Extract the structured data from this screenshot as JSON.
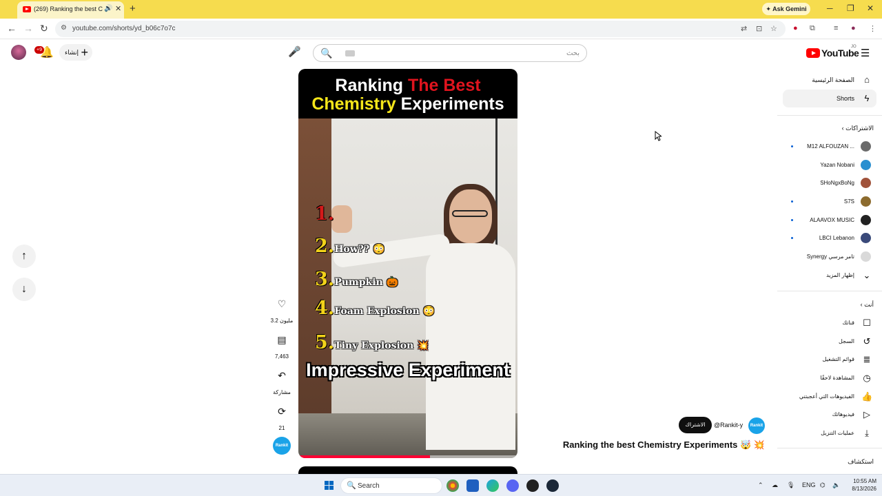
{
  "browser": {
    "tab_title": "(269) Ranking the best Che",
    "tab_audio_icon": "speaker-icon",
    "ask_gemini": "Ask Gemini",
    "url": "youtube.com/shorts/yd_b06c7o7c"
  },
  "header": {
    "notification_count": "+9",
    "create_label": "إنشاء",
    "search_placeholder": "بحث",
    "logo_text": "YouTube",
    "logo_country": "JO"
  },
  "short": {
    "title_line1_white": "Ranking ",
    "title_line1_red": "The Best",
    "title_line2_yellow": "Chemistry",
    "title_line2_white": " Experiments",
    "ranks": [
      {
        "num": "1.",
        "text": ""
      },
      {
        "num": "2.",
        "text": "How?? 😳"
      },
      {
        "num": "3.",
        "text": "Pumpkin 🎃"
      },
      {
        "num": "4.",
        "text": "Foam Explosion 😳"
      },
      {
        "num": "5.",
        "text": "Tiny Explosion 💥"
      }
    ],
    "caption": "Impressive Experiment",
    "progress": 0.6
  },
  "actions": {
    "likes": "3.2 مليون",
    "comments": "7,463",
    "share": "مشاركة",
    "remix": "21",
    "channel_avatar_text": "Rankit"
  },
  "video_info": {
    "subscribe": "الاشتراك",
    "handle": "@Rankit-y",
    "title": "Ranking the best Chemistry Experiments 🤯 💥"
  },
  "sidebar": {
    "home": "الصفحة الرئيسية",
    "shorts": "Shorts",
    "subscriptions_header": "الاشتراكات",
    "subscriptions": [
      {
        "name": "M12 ALFOUZAN ...",
        "color": "#6b6b6b",
        "dot": true
      },
      {
        "name": "Yazan Nobani",
        "color": "#2a8fd0",
        "dot": false
      },
      {
        "name": "SHoNgxBoNg",
        "color": "#a0523a",
        "dot": false
      },
      {
        "name": "S7S",
        "color": "#8c6b2e",
        "dot": true
      },
      {
        "name": "ALAAVOX MUSIC",
        "color": "#222222",
        "dot": true
      },
      {
        "name": "LBCI Lebanon",
        "color": "#3a4a7a",
        "dot": true
      },
      {
        "name": "Synergy تامر مرسي",
        "color": "#d9d9d9",
        "dot": false
      }
    ],
    "show_more": "إظهار المزيد",
    "you_header": "أنت",
    "you_items": [
      {
        "label": "قناتك",
        "icon": "channel-icon"
      },
      {
        "label": "السجل",
        "icon": "history-icon"
      },
      {
        "label": "قوائم التشغيل",
        "icon": "playlists-icon"
      },
      {
        "label": "المشاهدة لاحقًا",
        "icon": "watch-later-icon"
      },
      {
        "label": "الفيديوهات التي أعجبتني",
        "icon": "liked-icon"
      },
      {
        "label": "فيديوهاتك",
        "icon": "your-videos-icon"
      },
      {
        "label": "عمليات التنزيل",
        "icon": "downloads-icon"
      }
    ],
    "explore_header": "استكشاف"
  },
  "taskbar": {
    "search": "Search",
    "lang": "ENG",
    "time": "10:55 AM",
    "date": "8/13/2026",
    "discord_badge": "99"
  }
}
